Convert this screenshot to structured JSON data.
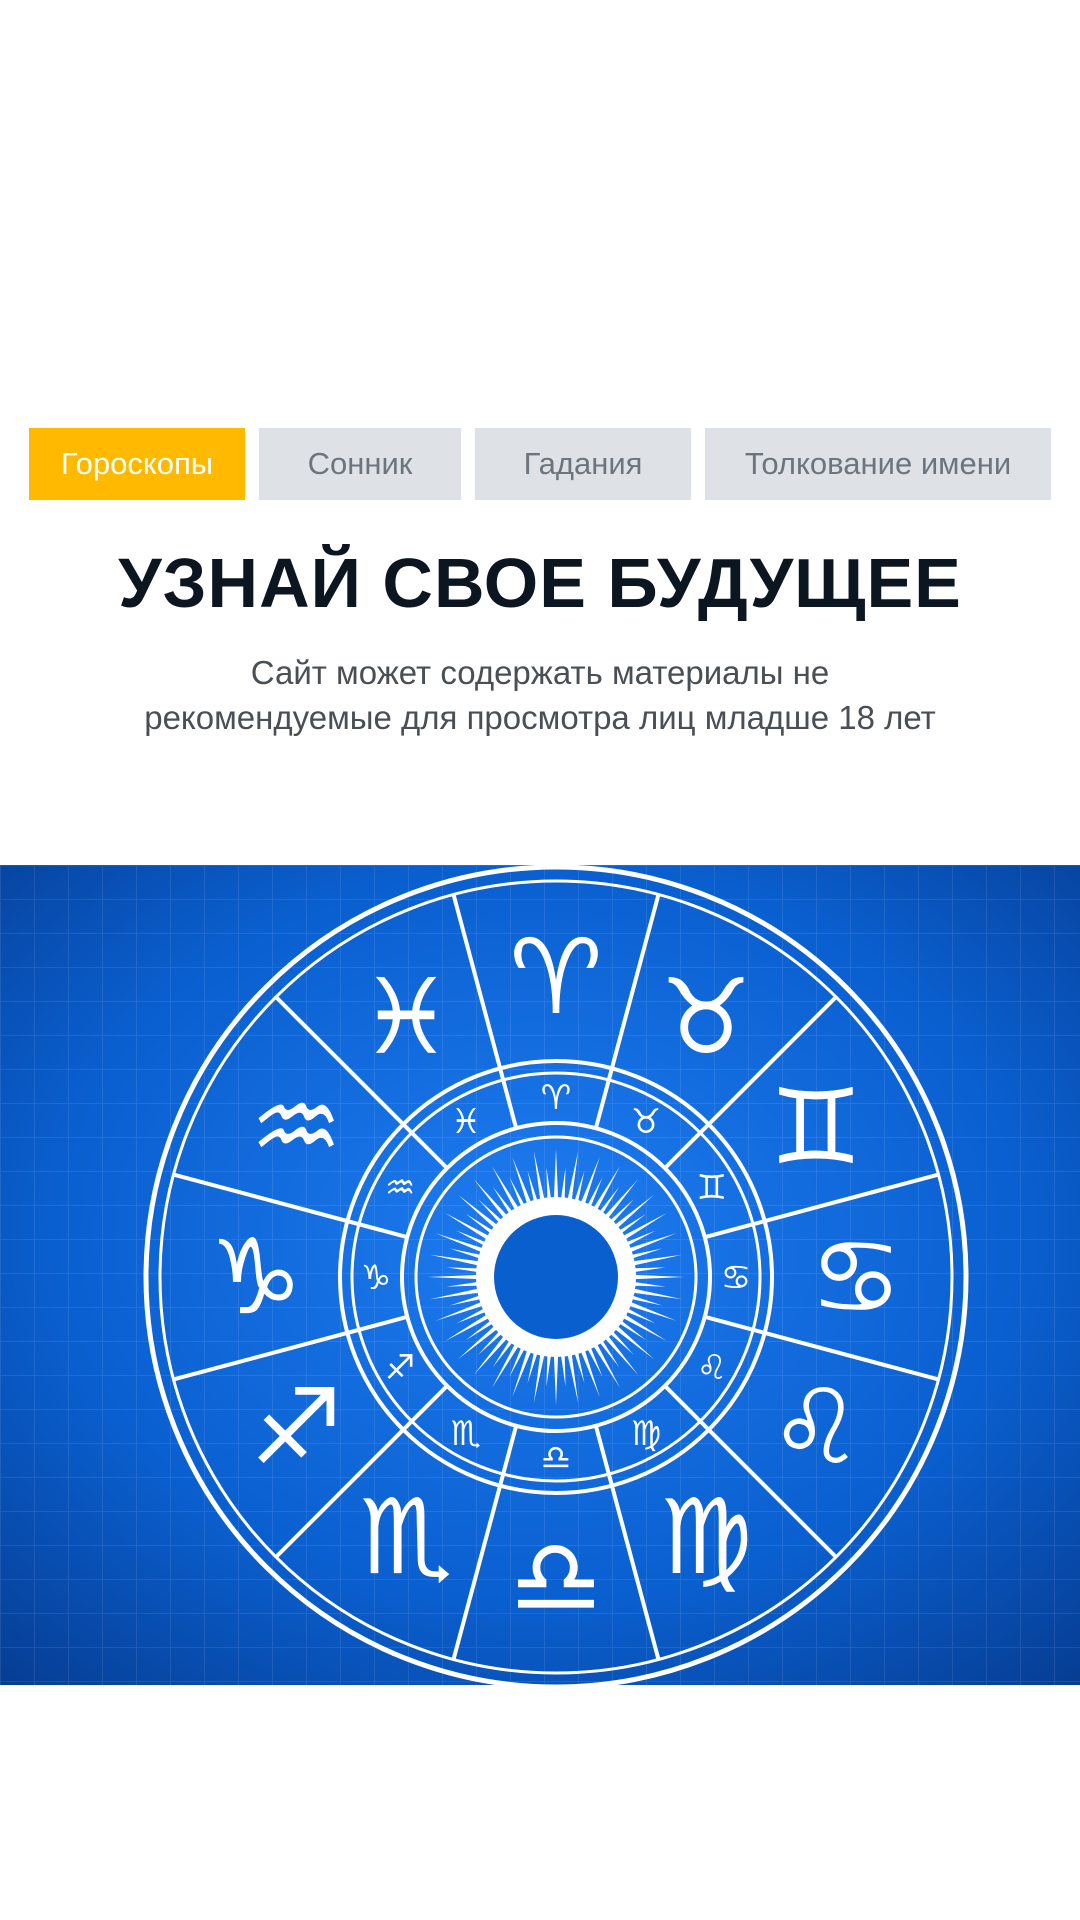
{
  "nav": {
    "tabs": [
      {
        "label": "Гороскопы",
        "active": true
      },
      {
        "label": "Сонник",
        "active": false
      },
      {
        "label": "Гадания",
        "active": false
      },
      {
        "label": "Толкование имени",
        "active": false
      }
    ]
  },
  "hero": {
    "title": "УЗНАЙ СВОЕ БУДУЩЕЕ",
    "subtitle_line1": "Сайт может содержать материалы не",
    "subtitle_line2": "рекомендуемые для просмотра лиц младше 18 лет"
  },
  "image": {
    "subject": "zodiac-wheel",
    "signs": [
      "♈",
      "♉",
      "♊",
      "♋",
      "♌",
      "♍",
      "♎",
      "♏",
      "♐",
      "♑",
      "♒",
      "♓"
    ]
  },
  "colors": {
    "accent": "#ffba00",
    "tab_bg": "#dee2e6",
    "tab_text": "#6c757d",
    "heading": "#0c1620",
    "body_text": "#4a4f55",
    "hero_blue": "#0a5fcf"
  }
}
